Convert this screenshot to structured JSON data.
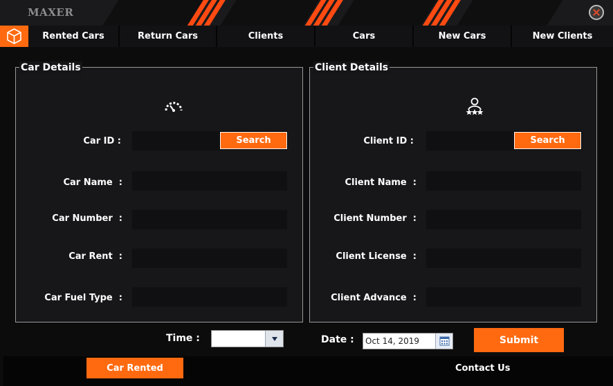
{
  "window": {
    "brand": "MAXER"
  },
  "nav": {
    "tabs": [
      {
        "label": "Rented Cars"
      },
      {
        "label": "Return Cars"
      },
      {
        "label": "Clients"
      },
      {
        "label": "Cars"
      },
      {
        "label": "New Cars"
      },
      {
        "label": "New Clients"
      }
    ]
  },
  "car_details": {
    "title": "Car Details",
    "id_label": "Car ID :",
    "search_label": "Search",
    "name_label": "Car Name  :",
    "number_label": "Car Number  :",
    "rent_label": "Car Rent  :",
    "fuel_label": "Car Fuel Type  :",
    "id_value": "",
    "name_value": "",
    "number_value": "",
    "rent_value": "",
    "fuel_value": ""
  },
  "client_details": {
    "title": "Client Details",
    "id_label": "Client ID :",
    "search_label": "Search",
    "name_label": "Client Name  :",
    "number_label": "Client Number  :",
    "license_label": "Client License  :",
    "advance_label": "Client Advance  :",
    "id_value": "",
    "name_value": "",
    "number_value": "",
    "license_value": "",
    "advance_value": ""
  },
  "bottom": {
    "time_label": "Time :",
    "time_value": "",
    "date_label": "Date :",
    "date_value": "Oct 14, 2019",
    "submit_label": "Submit"
  },
  "footer": {
    "car_rented_label": "Car Rented",
    "contact_label": "Contact Us"
  },
  "colors": {
    "accent": "#ff6a10",
    "background": "#0c0c0d",
    "panel": "#17171a",
    "input": "#101012"
  },
  "icons": {
    "home": "cube-icon",
    "close": "close-icon",
    "car_panel": "speedometer-icon",
    "client_panel": "user-stars-icon",
    "time_dropdown": "chevron-down-icon",
    "date_picker": "calendar-icon"
  }
}
